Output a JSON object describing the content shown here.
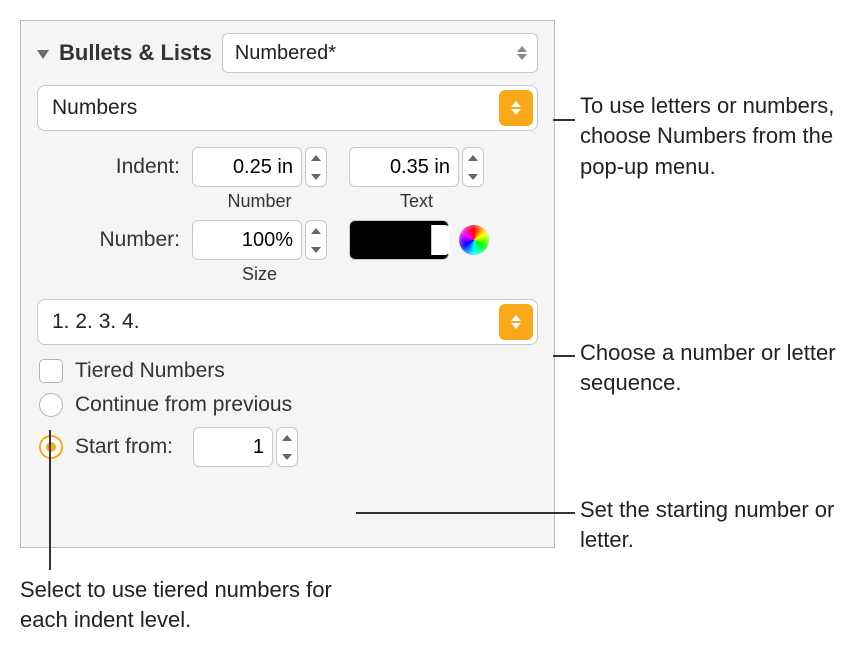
{
  "header": {
    "title": "Bullets & Lists",
    "style_value": "Numbered*"
  },
  "type_select": {
    "value": "Numbers"
  },
  "indent": {
    "label": "Indent:",
    "number_value": "0.25 in",
    "number_sublabel": "Number",
    "text_value": "0.35 in",
    "text_sublabel": "Text"
  },
  "number": {
    "label": "Number:",
    "size_value": "100%",
    "size_sublabel": "Size"
  },
  "sequence": {
    "value": "1. 2. 3. 4."
  },
  "tiered": {
    "label": "Tiered Numbers"
  },
  "continuation": {
    "continue_label": "Continue from previous",
    "start_label": "Start from:",
    "start_value": "1"
  },
  "callouts": {
    "type": "To use letters or numbers, choose Numbers from the pop-up menu.",
    "sequence": "Choose a number or letter sequence.",
    "start": "Set the starting number or letter.",
    "tiered": "Select to use tiered numbers for each indent level."
  }
}
